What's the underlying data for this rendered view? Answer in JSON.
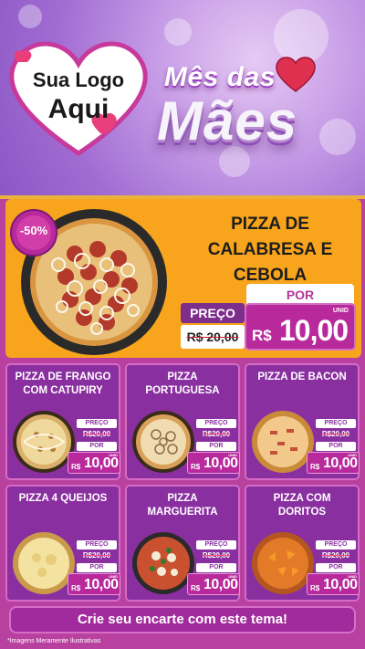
{
  "header": {
    "logo_line1": "Sua Logo",
    "logo_line2": "Aqui",
    "title_line1": "Mês das",
    "title_line2": "Mães"
  },
  "featured": {
    "discount": "-50%",
    "title_lines": [
      "PIZZA DE",
      "CALABRESA E",
      "CEBOLA"
    ],
    "por_label": "POR",
    "preco_label": "PREÇO",
    "old_price": "R$ 20,00",
    "currency": "R$",
    "price": "10,00",
    "unid": "UNID"
  },
  "cards": [
    {
      "title_lines": [
        "PIZZA DE FRANGO",
        "COM CATUPIRY"
      ],
      "preco_label": "PREÇO",
      "old_price": "R$20,00",
      "por_label": "POR",
      "currency": "R$",
      "price": "10,00",
      "unid": "UNID"
    },
    {
      "title_lines": [
        "PIZZA",
        "PORTUGUESA"
      ],
      "preco_label": "PREÇO",
      "old_price": "R$20,00",
      "por_label": "POR",
      "currency": "R$",
      "price": "10,00",
      "unid": "UNID"
    },
    {
      "title_lines": [
        "PIZZA DE BACON",
        ""
      ],
      "preco_label": "PREÇO",
      "old_price": "R$20,00",
      "por_label": "POR",
      "currency": "R$",
      "price": "10,00",
      "unid": "UNID"
    },
    {
      "title_lines": [
        "PIZZA 4 QUEIJOS",
        ""
      ],
      "preco_label": "PREÇO",
      "old_price": "R$20,00",
      "por_label": "POR",
      "currency": "R$",
      "price": "10,00",
      "unid": "UNID"
    },
    {
      "title_lines": [
        "PIZZA",
        "MARGUERITA"
      ],
      "preco_label": "PREÇO",
      "old_price": "R$20,00",
      "por_label": "POR",
      "currency": "R$",
      "price": "10,00",
      "unid": "UNID"
    },
    {
      "title_lines": [
        "PIZZA COM",
        "DORITOS"
      ],
      "preco_label": "PREÇO",
      "old_price": "R$20,00",
      "por_label": "POR",
      "currency": "R$",
      "price": "10,00",
      "unid": "UNID"
    }
  ],
  "cta": "Crie seu encarte com este tema!",
  "disclaimer": "*Imagens Meramente Ilustrativas",
  "colors": {
    "primary_purple": "#8a2fa0",
    "magenta": "#b8299c",
    "orange": "#f8a41c",
    "gold": "#e8b23b"
  }
}
